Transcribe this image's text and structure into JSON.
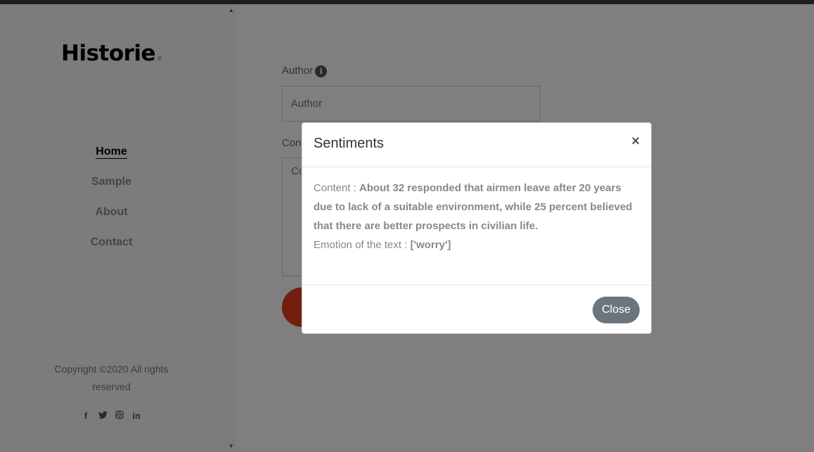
{
  "sidebar": {
    "logo_text": "Historie",
    "logo_dot": ".",
    "nav": [
      {
        "label": "Home",
        "active": true
      },
      {
        "label": "Sample"
      },
      {
        "label": "About"
      },
      {
        "label": "Contact"
      }
    ],
    "copyright_line1": "Copyright ©2020 All rights",
    "copyright_line2": "reserved",
    "social": [
      "f",
      "t",
      "ig",
      "in"
    ]
  },
  "form": {
    "author_label": "Author",
    "author_placeholder": "Author",
    "content_label": "Con",
    "content_placeholder": "Co"
  },
  "modal": {
    "title": "Sentiments",
    "close_x": "×",
    "content_label": "Content : ",
    "content_text": "About 32 responded that airmen leave after 20 years due to lack of a suitable environment, while 25 percent believed that there are better prospects in civilian life.",
    "emotion_label": "Emotion of the text : ",
    "emotion_value": "['worry']",
    "close_button": "Close"
  },
  "colors": {
    "accent": "#e63c1e",
    "close_button": "#6c757d"
  }
}
